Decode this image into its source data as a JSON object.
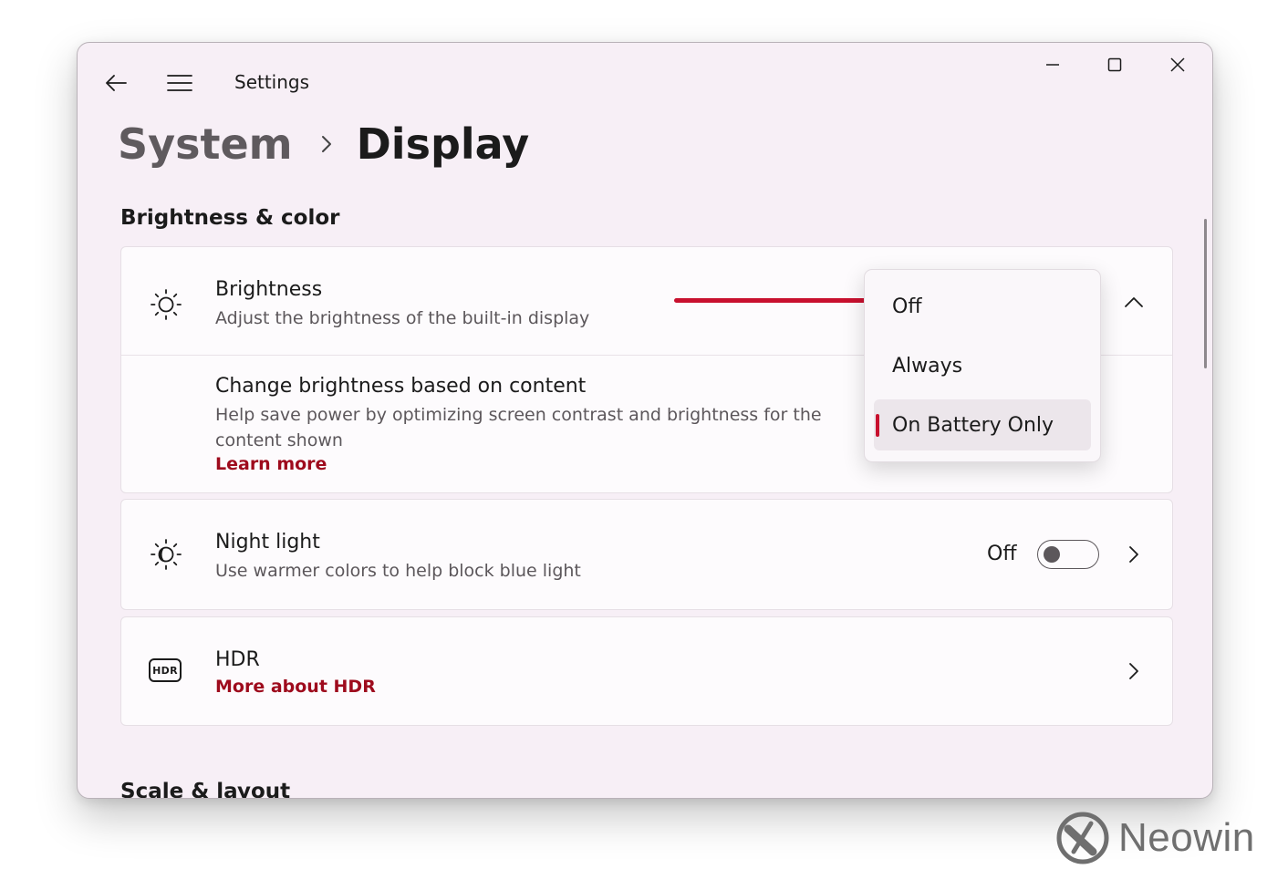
{
  "window": {
    "app_title": "Settings",
    "accent_color": "#c8102e",
    "link_color": "#9e0b1d"
  },
  "breadcrumb": {
    "parent": "System",
    "current": "Display"
  },
  "sections": {
    "brightness_color": "Brightness & color",
    "scale_layout": "Scale & layout"
  },
  "brightness": {
    "icon": "sun-icon",
    "title": "Brightness",
    "subtitle": "Adjust the brightness of the built-in display",
    "content_adaptive": {
      "title": "Change brightness based on content",
      "subtitle": "Help save power by optimizing screen contrast and brightness for the content shown",
      "link": "Learn more"
    },
    "dropdown": {
      "options": [
        "Off",
        "Always",
        "On Battery Only"
      ],
      "selected": "On Battery Only"
    }
  },
  "night_light": {
    "icon": "night-light-icon",
    "title": "Night light",
    "subtitle": "Use warmer colors to help block blue light",
    "toggle_label": "Off",
    "toggle_on": false
  },
  "hdr": {
    "icon": "hdr-icon",
    "icon_text": "HDR",
    "title": "HDR",
    "link": "More about HDR"
  },
  "watermark": {
    "text": "Neowin"
  }
}
